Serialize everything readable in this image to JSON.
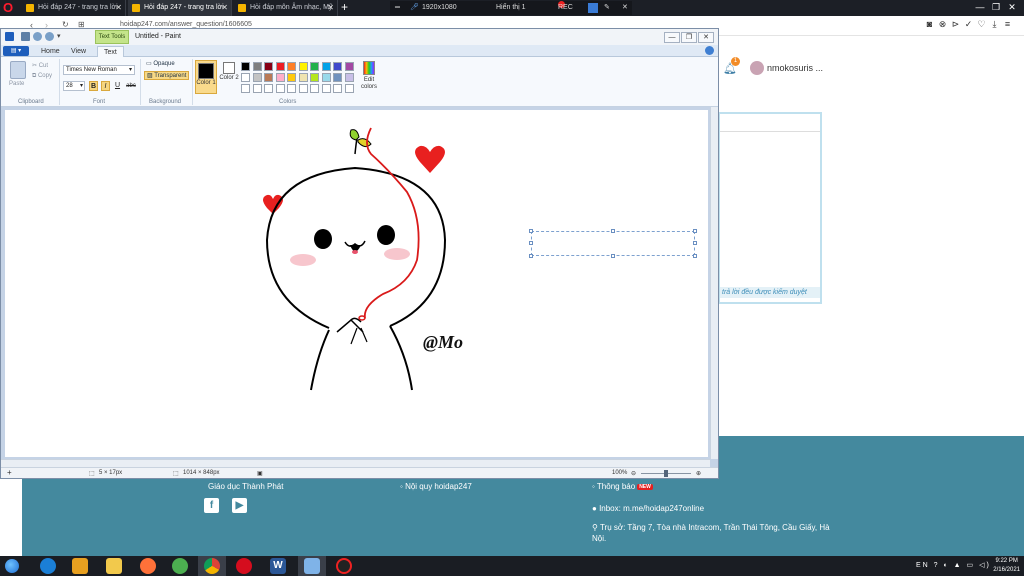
{
  "browser": {
    "tabs": [
      {
        "label": "Hỏi đáp 247 - trang tra lời"
      },
      {
        "label": "Hỏi đáp 247 - trang tra lời"
      },
      {
        "label": "Hỏi đáp môn Âm nhạc, Mỹ"
      }
    ],
    "recorder": {
      "resolution": "1920x1080",
      "display": "Hiển thị 1",
      "rec_label": "REC"
    },
    "url": "hoidap247.com/answer_question/1606605"
  },
  "website": {
    "notification_count": "1",
    "username": "nmokosuris ...",
    "side_note": "trả lời đều được kiểm duyệt",
    "footer": {
      "col1": "Giáo dục Thành Phát",
      "col2": "Nội quy hoidap247",
      "col3": "Thông báo",
      "new_badge": "NEW",
      "inbox": "Inbox: m.me/hoidap247online",
      "address": "Trụ sở: Tầng 7, Tòa nhà Intracom, Trần Thái Tông, Cầu Giấy, Hà Nội."
    }
  },
  "paint": {
    "title": "Untitled - Paint",
    "contextual_tab": "Text Tools",
    "tabs": [
      "Home",
      "View",
      "Text"
    ],
    "active_tab": "Text",
    "clipboard": {
      "paste": "Paste",
      "cut": "Cut",
      "copy": "Copy",
      "label": "Clipboard"
    },
    "font": {
      "family": "Times New Roman",
      "size": "28",
      "label": "Font",
      "bold": "B",
      "italic": "I",
      "underline": "U",
      "strike": "abc"
    },
    "background": {
      "opaque": "Opaque",
      "transparent": "Transparent",
      "label": "Background"
    },
    "colors": {
      "color1": "Color 1",
      "color2": "Color 2",
      "edit": "Edit colors",
      "label": "Colors"
    },
    "palette_row1": [
      "#000000",
      "#7f7f7f",
      "#880015",
      "#ed1c24",
      "#ff7f27",
      "#fff200",
      "#22b14c",
      "#00a2e8",
      "#3f48cc",
      "#a349a4"
    ],
    "palette_row2": [
      "#ffffff",
      "#c3c3c3",
      "#b97a57",
      "#ffaec9",
      "#ffc90e",
      "#efe4b0",
      "#b5e61d",
      "#99d9ea",
      "#7092be",
      "#c8bfe7"
    ],
    "palette_row3": [
      "#ffffff",
      "#ffffff",
      "#ffffff",
      "#ffffff",
      "#ffffff",
      "#ffffff",
      "#ffffff",
      "#ffffff",
      "#ffffff",
      "#ffffff"
    ],
    "signature": "@Mo",
    "status": {
      "cursor": "5 × 17px",
      "size": "1014 × 848px",
      "zoom": "100%"
    }
  },
  "taskbar": {
    "time": "9:22 PM",
    "date": "2/16/2021"
  },
  "colors": {
    "footer": "#44899e",
    "taskbar": "#1a1d23",
    "ribbon": "#f6f9fd"
  }
}
